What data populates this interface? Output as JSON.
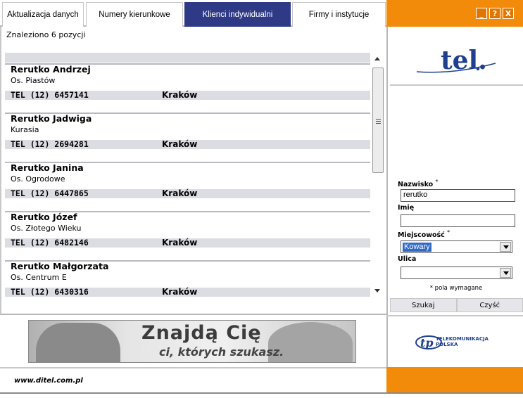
{
  "tabs": [
    {
      "label": "Aktualizacja danych",
      "active": false
    },
    {
      "label": "Numery kierunkowe",
      "active": false
    },
    {
      "label": "Klienci indywidualni",
      "active": true
    },
    {
      "label": "Firmy i instytucje",
      "active": false
    }
  ],
  "window_buttons": {
    "minimize": "_",
    "help": "?",
    "close": "X"
  },
  "results": {
    "summary": "Znaleziono 6 pozycji",
    "entries": [
      {
        "name": "Rerutko Andrzej",
        "street": "Os. Piastów",
        "phone": "TEL (12) 6457141",
        "city": "Kraków"
      },
      {
        "name": "Rerutko Jadwiga",
        "street": "Kurasia",
        "phone": "TEL (12) 2694281",
        "city": "Kraków"
      },
      {
        "name": "Rerutko Janina",
        "street": "Os. Ogrodowe",
        "phone": "TEL (12) 6447865",
        "city": "Kraków"
      },
      {
        "name": "Rerutko Józef",
        "street": "Os. Złotego Wieku",
        "phone": "TEL (12) 6482146",
        "city": "Kraków"
      },
      {
        "name": "Rerutko Małgorzata",
        "street": "Os. Centrum E",
        "phone": "TEL (12) 6430316",
        "city": "Kraków"
      }
    ]
  },
  "search": {
    "logo_text": "tel.",
    "surname_label": "Nazwisko",
    "surname_value": "rerutko",
    "firstname_label": "Imię",
    "firstname_value": "",
    "city_label": "Miejscowość",
    "city_value": "Kowary",
    "street_label": "Ulica",
    "street_value": "",
    "required_mark": "*",
    "required_note": "* pola wymagane",
    "search_button": "Szukaj",
    "clear_button": "Czyść"
  },
  "banner": {
    "line1": "Znajdą Cię",
    "line2": "ci, których szukasz."
  },
  "partner": {
    "line1": "TELEKOMUNIKACJA",
    "line2": "POLSKA"
  },
  "footer": {
    "url": "www.ditel.com.pl"
  },
  "colors": {
    "accent": "#f28a0a",
    "active_tab": "#2e3a86",
    "row_bar": "#dcdde3",
    "logo_blue": "#1f3f8f"
  }
}
